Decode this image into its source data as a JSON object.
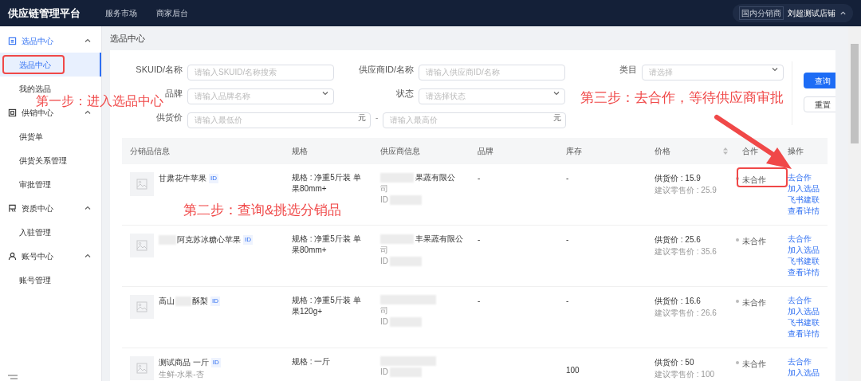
{
  "header": {
    "title": "供应链管理平台",
    "nav": [
      {
        "label": "服务市场"
      },
      {
        "label": "商家后台"
      }
    ],
    "account": {
      "badge": "国内分销商",
      "name": "刘超测试店铺"
    }
  },
  "sidebar": {
    "groups": [
      {
        "label": "选品中心",
        "expanded": true,
        "items": [
          {
            "label": "选品中心",
            "selected": true
          },
          {
            "label": "我的选品",
            "selected": false
          }
        ]
      },
      {
        "label": "供销中心",
        "expanded": true,
        "items": [
          {
            "label": "供货单",
            "selected": false
          },
          {
            "label": "供货关系管理",
            "selected": false
          },
          {
            "label": "审批管理",
            "selected": false
          }
        ]
      },
      {
        "label": "资质中心",
        "expanded": true,
        "items": [
          {
            "label": "入驻管理",
            "selected": false
          }
        ]
      },
      {
        "label": "账号中心",
        "expanded": true,
        "items": [
          {
            "label": "账号管理",
            "selected": false
          }
        ]
      }
    ]
  },
  "page_title": "选品中心",
  "filters": [
    {
      "kind": "text",
      "label": "SKUID/名称",
      "placeholder": "请输入SKUID/名称搜索"
    },
    {
      "kind": "text",
      "label": "供应商ID/名称",
      "placeholder": "请输入供应商ID/名称"
    },
    {
      "kind": "select",
      "label": "类目",
      "placeholder": "请选择"
    },
    {
      "kind": "select",
      "label": "品牌",
      "placeholder": "请输入品牌名称"
    },
    {
      "kind": "select",
      "label": "状态",
      "placeholder": "请选择状态"
    },
    {
      "kind": "range",
      "label": "供货价",
      "placeholder": "请输入最低价",
      "unit": "元",
      "separator": "-",
      "placeholder_2": "请输入最高价",
      "unit_2": "元"
    }
  ],
  "buttons": [
    {
      "label": "查询",
      "primary": true
    },
    {
      "label": "重置",
      "primary": false
    }
  ],
  "table": {
    "columns": [
      "分销品信息",
      "规格",
      "供应商信息",
      "品牌",
      "库存",
      "价格",
      "合作",
      "操作"
    ],
    "rows": [
      {
        "name_parts": [
          "甘肃花牛苹果"
        ],
        "redacted_prefix": false,
        "id_tag": "ID",
        "spec": "规格 : 净重5斤装 单果80mm+",
        "supplier": [
          "果蔬有限公",
          "司",
          "ID"
        ],
        "brand": "-",
        "stock": "-",
        "price": "供货价 : 15.9",
        "retail": "建议零售价 : 25.9",
        "status": "未合作",
        "cooperating": false,
        "actions": [
          "去合作",
          "加入选品",
          "飞书建联",
          "查看详情"
        ]
      },
      {
        "name_parts": [
          "阿克苏冰糖心苹果"
        ],
        "redacted_prefix": true,
        "id_tag": "ID",
        "spec": "规格 : 净重5斤装 单果80mm+",
        "supplier": [
          "丰果蔬有限公",
          "司",
          "ID"
        ],
        "brand": "-",
        "stock": "-",
        "price": "供货价 : 25.6",
        "retail": "建议零售价 : 35.6",
        "status": "未合作",
        "cooperating": false,
        "actions": [
          "去合作",
          "加入选品",
          "飞书建联",
          "查看详情"
        ]
      },
      {
        "name_parts": [
          "高山",
          "酥梨"
        ],
        "redacted_prefix": false,
        "id_tag": "ID",
        "spec": "规格 : 净重5斤装 单果120g+",
        "supplier": [
          "司",
          "ID"
        ],
        "brand": "-",
        "stock": "-",
        "price": "供货价 : 16.6",
        "retail": "建议零售价 : 26.6",
        "status": "未合作",
        "cooperating": false,
        "actions": [
          "去合作",
          "加入选品",
          "飞书建联",
          "查看详情"
        ]
      },
      {
        "name_parts": [
          "测试商品 一斤"
        ],
        "redacted_prefix": false,
        "id_tag": "ID",
        "category": "生鲜-水果-杏",
        "spec": "规格 : 一斤",
        "supplier": [
          "ID"
        ],
        "stock": "100",
        "price": "供货价 : 50",
        "retail": "建议零售价 : 100",
        "status": "未合作",
        "cooperating": false,
        "actions": [
          "去合作",
          "加入选品"
        ]
      }
    ]
  },
  "annotations": [
    {
      "text": "第一步：进入选品中心"
    },
    {
      "text": "第二步：查询&挑选分销品"
    },
    {
      "text": "第三步：去合作，等待供应商审批"
    }
  ]
}
